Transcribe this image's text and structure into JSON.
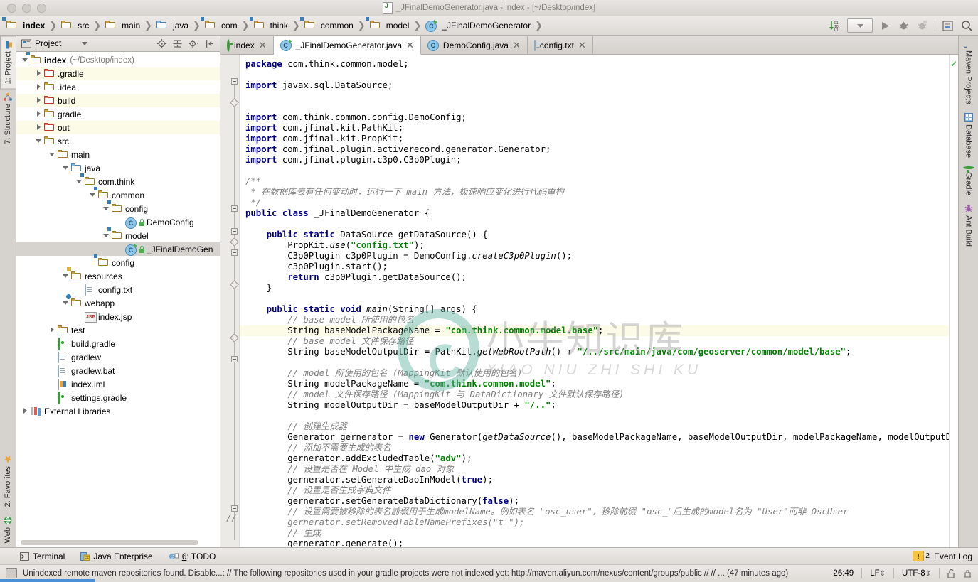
{
  "window": {
    "title": "_JFinalDemoGenerator.java - index - [~/Desktop/index]",
    "file_icon": "java-file-icon"
  },
  "breadcrumb": {
    "items": [
      {
        "label": "index",
        "icon": "module-folder-icon",
        "bold": true
      },
      {
        "label": "src",
        "icon": "folder-icon",
        "bold": false
      },
      {
        "label": "main",
        "icon": "folder-icon",
        "bold": false
      },
      {
        "label": "java",
        "icon": "source-folder-icon",
        "bold": false
      },
      {
        "label": "com",
        "icon": "package-folder-icon",
        "bold": false
      },
      {
        "label": "think",
        "icon": "package-folder-icon",
        "bold": false
      },
      {
        "label": "common",
        "icon": "package-folder-icon",
        "bold": false
      },
      {
        "label": "model",
        "icon": "package-folder-icon",
        "bold": false
      },
      {
        "label": "_JFinalDemoGenerator",
        "icon": "class-runnable-icon",
        "bold": false
      }
    ],
    "toolbar_icons": [
      "sort-numeric-icon",
      "run-config-dropdown",
      "run-icon",
      "debug-icon",
      "coverage-icon",
      "build-project-icon",
      "search-everywhere-icon"
    ]
  },
  "left_strip": {
    "top": [
      {
        "label": "1: Project",
        "icon": "project-icon",
        "selected": true
      },
      {
        "label": "7: Structure",
        "icon": "structure-icon",
        "selected": false
      }
    ],
    "bottom": [
      {
        "label": "2: Favorites",
        "icon": "star-icon",
        "selected": false
      },
      {
        "label": "Web",
        "icon": "web-icon",
        "selected": false
      }
    ]
  },
  "right_strip": {
    "items": [
      {
        "label": "Maven Projects",
        "icon": "maven-icon"
      },
      {
        "label": "Database",
        "icon": "database-icon"
      },
      {
        "label": "Gradle",
        "icon": "gradle-icon"
      },
      {
        "label": "Ant Build",
        "icon": "ant-icon"
      }
    ]
  },
  "project_panel": {
    "title": "Project",
    "title_icon": "project-view-icon",
    "dropdown_icon": "chevron-down-icon",
    "toolbar_icons": [
      "locate-icon",
      "collapse-all-icon",
      "settings-gear-icon",
      "hide-panel-icon"
    ],
    "tree": [
      {
        "label": "index",
        "sub": "(~/Desktop/index)",
        "depth": 0,
        "arrow": "open",
        "icon": "module-folder-icon",
        "bold": true,
        "state": "none"
      },
      {
        "label": ".gradle",
        "sub": "",
        "depth": 1,
        "arrow": "closed",
        "icon": "folder-red-icon",
        "bold": false,
        "state": "hl"
      },
      {
        "label": ".idea",
        "sub": "",
        "depth": 1,
        "arrow": "closed",
        "icon": "folder-icon",
        "bold": false,
        "state": "none"
      },
      {
        "label": "build",
        "sub": "",
        "depth": 1,
        "arrow": "closed",
        "icon": "folder-red-icon",
        "bold": false,
        "state": "hl"
      },
      {
        "label": "gradle",
        "sub": "",
        "depth": 1,
        "arrow": "closed",
        "icon": "folder-icon",
        "bold": false,
        "state": "none"
      },
      {
        "label": "out",
        "sub": "",
        "depth": 1,
        "arrow": "closed",
        "icon": "folder-red-icon",
        "bold": false,
        "state": "hl"
      },
      {
        "label": "src",
        "sub": "",
        "depth": 1,
        "arrow": "open",
        "icon": "folder-icon",
        "bold": false,
        "state": "none"
      },
      {
        "label": "main",
        "sub": "",
        "depth": 2,
        "arrow": "open",
        "icon": "folder-icon",
        "bold": false,
        "state": "none"
      },
      {
        "label": "java",
        "sub": "",
        "depth": 3,
        "arrow": "open",
        "icon": "source-folder-icon",
        "bold": false,
        "state": "none"
      },
      {
        "label": "com.think",
        "sub": "",
        "depth": 4,
        "arrow": "open",
        "icon": "package-folder-icon",
        "bold": false,
        "state": "none"
      },
      {
        "label": "common",
        "sub": "",
        "depth": 5,
        "arrow": "open",
        "icon": "package-folder-icon",
        "bold": false,
        "state": "none"
      },
      {
        "label": "config",
        "sub": "",
        "depth": 6,
        "arrow": "open",
        "icon": "package-folder-icon",
        "bold": false,
        "state": "none"
      },
      {
        "label": "DemoConfig",
        "sub": "",
        "depth": 7,
        "arrow": "none",
        "icon": "class-icon",
        "bold": false,
        "state": "none"
      },
      {
        "label": "model",
        "sub": "",
        "depth": 6,
        "arrow": "open",
        "icon": "package-folder-icon",
        "bold": false,
        "state": "none"
      },
      {
        "label": "_JFinalDemoGen",
        "sub": "",
        "depth": 7,
        "arrow": "none",
        "icon": "class-runnable-icon",
        "bold": false,
        "state": "sel"
      },
      {
        "label": "config",
        "sub": "",
        "depth": 5,
        "arrow": "none",
        "icon": "package-folder-icon",
        "bold": false,
        "state": "none"
      },
      {
        "label": "resources",
        "sub": "",
        "depth": 3,
        "arrow": "open",
        "icon": "resources-folder-icon",
        "bold": false,
        "state": "none"
      },
      {
        "label": "config.txt",
        "sub": "",
        "depth": 4,
        "arrow": "none",
        "icon": "text-file-icon",
        "bold": false,
        "state": "none"
      },
      {
        "label": "webapp",
        "sub": "",
        "depth": 3,
        "arrow": "open",
        "icon": "webapp-folder-icon",
        "bold": false,
        "state": "none"
      },
      {
        "label": "index.jsp",
        "sub": "",
        "depth": 4,
        "arrow": "none",
        "icon": "jsp-file-icon",
        "bold": false,
        "state": "none"
      },
      {
        "label": "test",
        "sub": "",
        "depth": 2,
        "arrow": "closed",
        "icon": "folder-icon",
        "bold": false,
        "state": "none"
      },
      {
        "label": "build.gradle",
        "sub": "",
        "depth": 2,
        "arrow": "none",
        "icon": "gradle-file-icon",
        "bold": false,
        "state": "none"
      },
      {
        "label": "gradlew",
        "sub": "",
        "depth": 2,
        "arrow": "none",
        "icon": "text-file-icon",
        "bold": false,
        "state": "none"
      },
      {
        "label": "gradlew.bat",
        "sub": "",
        "depth": 2,
        "arrow": "none",
        "icon": "text-file-icon",
        "bold": false,
        "state": "none"
      },
      {
        "label": "index.iml",
        "sub": "",
        "depth": 2,
        "arrow": "none",
        "icon": "iml-file-icon",
        "bold": false,
        "state": "none"
      },
      {
        "label": "settings.gradle",
        "sub": "",
        "depth": 2,
        "arrow": "none",
        "icon": "gradle-file-icon",
        "bold": false,
        "state": "none"
      },
      {
        "label": "External Libraries",
        "sub": "",
        "depth": 0,
        "arrow": "closed",
        "icon": "library-icon",
        "bold": false,
        "state": "none"
      }
    ]
  },
  "editor_tabs": [
    {
      "label": "index",
      "icon": "gradle-icon",
      "active": false
    },
    {
      "label": "_JFinalDemoGenerator.java",
      "icon": "class-runnable-icon",
      "active": true
    },
    {
      "label": "DemoConfig.java",
      "icon": "class-icon",
      "active": false
    },
    {
      "label": "config.txt",
      "icon": "text-file-icon",
      "active": false
    }
  ],
  "code": {
    "language": "java",
    "gutter_comment": "//",
    "lines": [
      [
        {
          "t": "package ",
          "c": "kw"
        },
        {
          "t": "com.think.common.model;",
          "c": ""
        }
      ],
      [],
      [
        {
          "t": "import ",
          "c": "kw"
        },
        {
          "t": "javax.sql.DataSource;",
          "c": ""
        }
      ],
      [],
      [],
      [
        {
          "t": "import ",
          "c": "kw"
        },
        {
          "t": "com.think.common.config.DemoConfig;",
          "c": ""
        }
      ],
      [
        {
          "t": "import ",
          "c": "kw"
        },
        {
          "t": "com.jfinal.kit.PathKit;",
          "c": ""
        }
      ],
      [
        {
          "t": "import ",
          "c": "kw"
        },
        {
          "t": "com.jfinal.kit.PropKit;",
          "c": ""
        }
      ],
      [
        {
          "t": "import ",
          "c": "kw"
        },
        {
          "t": "com.jfinal.plugin.activerecord.generator.Generator;",
          "c": ""
        }
      ],
      [
        {
          "t": "import ",
          "c": "kw"
        },
        {
          "t": "com.jfinal.plugin.c3p0.C3p0Plugin;",
          "c": ""
        }
      ],
      [],
      [
        {
          "t": "/**",
          "c": "cmt"
        }
      ],
      [
        {
          "t": " * 在数据库表有任何变动时，运行一下 ",
          "c": "cmt"
        },
        {
          "t": "main",
          "c": "cmt"
        },
        {
          "t": " 方法，极速响应变化进行代码重构",
          "c": "cmt"
        }
      ],
      [
        {
          "t": " */",
          "c": "cmt"
        }
      ],
      [
        {
          "t": "public class ",
          "c": "kw"
        },
        {
          "t": "_JFinalDemoGenerator {",
          "c": ""
        }
      ],
      [],
      [
        {
          "t": "    public static ",
          "c": "kw"
        },
        {
          "t": "DataSource getDataSource() {",
          "c": ""
        }
      ],
      [
        {
          "t": "        PropKit.",
          "c": ""
        },
        {
          "t": "use",
          "c": "mth"
        },
        {
          "t": "(",
          "c": ""
        },
        {
          "t": "\"config.txt\"",
          "c": "str"
        },
        {
          "t": ");",
          "c": ""
        }
      ],
      [
        {
          "t": "        C3p0Plugin c3p0Plugin = DemoConfig.",
          "c": ""
        },
        {
          "t": "createC3p0Plugin",
          "c": "mth"
        },
        {
          "t": "();",
          "c": ""
        }
      ],
      [
        {
          "t": "        c3p0Plugin.start();",
          "c": ""
        }
      ],
      [
        {
          "t": "        return ",
          "c": "kw"
        },
        {
          "t": "c3p0Plugin.getDataSource();",
          "c": ""
        }
      ],
      [
        {
          "t": "    }",
          "c": ""
        }
      ],
      [],
      [
        {
          "t": "    public static void ",
          "c": "kw"
        },
        {
          "t": "main",
          "c": "mth"
        },
        {
          "t": "(String[] args) {",
          "c": ""
        }
      ],
      [
        {
          "t": "        // base model 所使用的包名",
          "c": "cmt"
        }
      ],
      [
        {
          "t": "        String baseModelPackageName = ",
          "c": ""
        },
        {
          "t": "\"com.think.common.model.base\"",
          "c": "str"
        },
        {
          "t": ";",
          "c": ""
        }
      ],
      [
        {
          "t": "        // base model 文件保存路径",
          "c": "cmt"
        }
      ],
      [
        {
          "t": "        String baseModelOutputDir = PathKit.",
          "c": ""
        },
        {
          "t": "getWebRootPath",
          "c": "mth"
        },
        {
          "t": "() + ",
          "c": ""
        },
        {
          "t": "\"/../src/main/java/com/geoserver/common/model/base\"",
          "c": "str"
        },
        {
          "t": ";",
          "c": ""
        }
      ],
      [],
      [
        {
          "t": "        // model 所使用的包名 (MappingKit 默认使用的包名)",
          "c": "cmt"
        }
      ],
      [
        {
          "t": "        String modelPackageName = ",
          "c": ""
        },
        {
          "t": "\"com.think.common.model\"",
          "c": "str"
        },
        {
          "t": ";",
          "c": ""
        }
      ],
      [
        {
          "t": "        // model 文件保存路径 (MappingKit 与 DataDictionary 文件默认保存路径)",
          "c": "cmt"
        }
      ],
      [
        {
          "t": "        String modelOutputDir = baseModelOutputDir + ",
          "c": ""
        },
        {
          "t": "\"/..\"",
          "c": "str"
        },
        {
          "t": ";",
          "c": ""
        }
      ],
      [],
      [
        {
          "t": "        // 创建生成器",
          "c": "cmt"
        }
      ],
      [
        {
          "t": "        Generator gernerator = ",
          "c": ""
        },
        {
          "t": "new ",
          "c": "kw"
        },
        {
          "t": "Generator(",
          "c": ""
        },
        {
          "t": "getDataSource",
          "c": "mth"
        },
        {
          "t": "(), baseModelPackageName, baseModelOutputDir, modelPackageName, modelOutputDir);",
          "c": ""
        }
      ],
      [
        {
          "t": "        // 添加不需要生成的表名",
          "c": "cmt"
        }
      ],
      [
        {
          "t": "        gernerator.addExcludedTable(",
          "c": ""
        },
        {
          "t": "\"adv\"",
          "c": "str"
        },
        {
          "t": ");",
          "c": ""
        }
      ],
      [
        {
          "t": "        // 设置是否在 Model 中生成 dao 对象",
          "c": "cmt"
        }
      ],
      [
        {
          "t": "        gernerator.setGenerateDaoInModel(",
          "c": ""
        },
        {
          "t": "true",
          "c": "kw"
        },
        {
          "t": ");",
          "c": ""
        }
      ],
      [
        {
          "t": "        // 设置是否生成字典文件",
          "c": "cmt"
        }
      ],
      [
        {
          "t": "        gernerator.setGenerateDataDictionary(",
          "c": ""
        },
        {
          "t": "false",
          "c": "kw"
        },
        {
          "t": ");",
          "c": ""
        }
      ],
      [
        {
          "t": "        // 设置需要被移除的表名前缀用于生成modelName。例如表名 \"osc_user\"，移除前缀 \"osc_\"后生成的model名为 \"User\"而非 OscUser",
          "c": "cmt"
        }
      ],
      [
        {
          "t": "        gernerator.setRemovedTableNamePrefixes(\"t_\");",
          "c": "cmtcode"
        }
      ],
      [
        {
          "t": "        // 生成",
          "c": "cmt"
        }
      ],
      [
        {
          "t": "        gernerator.generate();",
          "c": ""
        }
      ],
      [
        {
          "t": "    }",
          "c": ""
        }
      ]
    ],
    "highlighted_line_index": 25
  },
  "watermark": {
    "chinese": "小牛知识库",
    "pinyin": "XIAO NIU ZHI SHI KU"
  },
  "bottom_tabs": [
    {
      "label": "Terminal",
      "icon": "terminal-icon"
    },
    {
      "label": "Java Enterprise",
      "icon": "java-enterprise-icon"
    },
    {
      "label": "6: TODO",
      "icon": "todo-icon"
    }
  ],
  "event_log": {
    "label": "Event Log",
    "count": "2",
    "icon": "notification-icon"
  },
  "status_bar": {
    "message": "Unindexed remote maven repositories found. Disable...: // The following repositories used in your gradle projects were not indexed yet: http://maven.aliyun.com/nexus/content/groups/public // // ... (47 minutes ago)",
    "caret_position": "26:49",
    "line_separator": "LF",
    "encoding": "UTF-8",
    "lock_icon": "unlocked-icon",
    "inspector_icon": "inspection-icon",
    "monitor_icon": "memory-monitor-icon"
  },
  "colors": {
    "accent_blue": "#4a90d9",
    "keyword": "#000080",
    "string": "#008000",
    "comment": "#808080",
    "highlight_line": "#fcfbe8",
    "selection": "#d6d2ce"
  }
}
